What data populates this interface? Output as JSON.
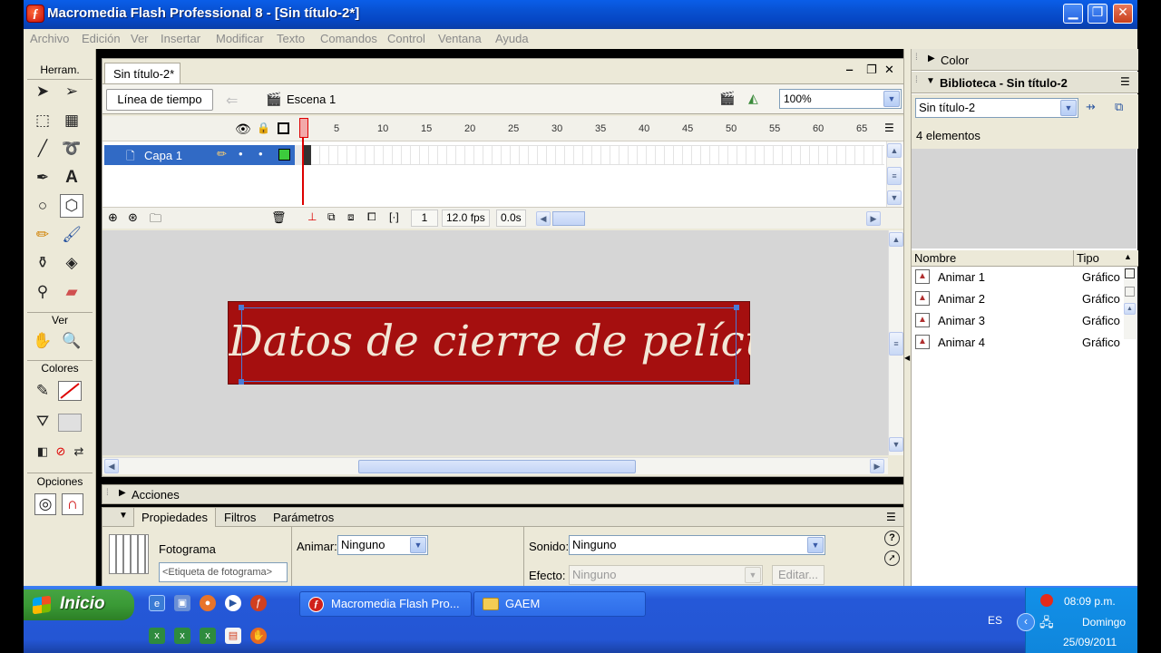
{
  "window": {
    "title": "Macromedia Flash Professional 8 - [Sin título-2*]",
    "icon_letter": "ƒ",
    "minimize": "▁",
    "restore": "❐",
    "close": "✕"
  },
  "menu": [
    "Archivo",
    "Edición",
    "Ver",
    "Insertar",
    "Modificar",
    "Texto",
    "Comandos",
    "Control",
    "Ventana",
    "Ayuda"
  ],
  "tools": {
    "header": "Herram.",
    "view_header": "Ver",
    "colors_header": "Colores",
    "options_header": "Opciones"
  },
  "document": {
    "tab": "Sin título-2*",
    "timeline_button": "Línea de tiempo",
    "scene": "Escena 1",
    "zoom": "100%",
    "minimize": "‒",
    "restore": "❐",
    "close": "✕"
  },
  "timeline": {
    "frame_numbers": [
      "1",
      "5",
      "10",
      "15",
      "20",
      "25",
      "30",
      "35",
      "40",
      "45",
      "50",
      "55",
      "60",
      "65"
    ],
    "layer_name": "Capa 1",
    "current_frame": "1",
    "fps": "12.0 fps",
    "time": "0.0s"
  },
  "stage": {
    "banner_text": "Datos de cierre de película",
    "banner_color": "#a50f0f"
  },
  "panels": {
    "actions": "Acciones",
    "properties_tab": "Propiedades",
    "filters_tab": "Filtros",
    "parameters_tab": "Parámetros"
  },
  "properties": {
    "frame_label": "Fotograma",
    "frame_label_placeholder": "<Etiqueta de fotograma>",
    "tween_label": "Animar:",
    "tween_value": "Ninguno",
    "sound_label": "Sonido:",
    "sound_value": "Ninguno",
    "effect_label": "Efecto:",
    "effect_value": "Ninguno",
    "edit_button": "Editar..."
  },
  "right": {
    "color_panel": "Color",
    "library_panel": "Biblioteca - Sin título-2",
    "library_select": "Sin título-2",
    "item_count": "4 elementos",
    "col_name": "Nombre",
    "col_type": "Tipo",
    "items": [
      {
        "name": "Animar 1",
        "type": "Gráfico"
      },
      {
        "name": "Animar 2",
        "type": "Gráfico"
      },
      {
        "name": "Animar 3",
        "type": "Gráfico"
      },
      {
        "name": "Animar 4",
        "type": "Gráfico"
      }
    ]
  },
  "taskbar": {
    "start": "Inicio",
    "tasks": [
      "Macromedia Flash Pro...",
      "GAEM"
    ],
    "lang": "ES",
    "time": "08:09 p.m.",
    "day": "Domingo",
    "date": "25/09/2011"
  }
}
